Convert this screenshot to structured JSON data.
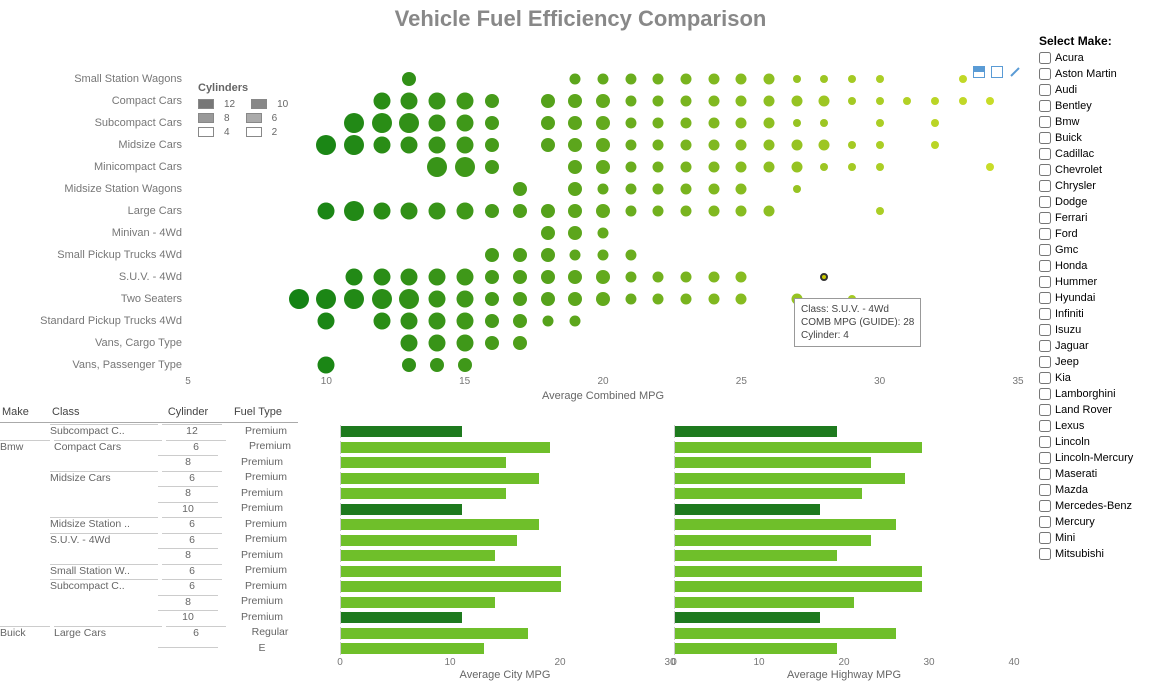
{
  "title": "Vehicle Fuel Efficiency Comparison",
  "toolbar": {
    "img_icon": "image-export",
    "win_icon": "window",
    "pen_icon": "edit"
  },
  "tooltip": {
    "line1": "Class: S.U.V. - 4Wd",
    "line2": "COMB MPG (GUIDE): 28",
    "line3": "Cylinder: 4"
  },
  "bubble_legend": {
    "title": "Cylinders",
    "items": [
      "12",
      "10",
      "8",
      "6",
      "4",
      "2"
    ]
  },
  "bubble_axis": {
    "title": "Average Combined MPG",
    "min": 5,
    "max": 35,
    "ticks": [
      5,
      10,
      15,
      20,
      25,
      30,
      35
    ]
  },
  "filter": {
    "title": "Select Make:",
    "makes": [
      "Acura",
      "Aston Martin",
      "Audi",
      "Bentley",
      "Bmw",
      "Buick",
      "Cadillac",
      "Chevrolet",
      "Chrysler",
      "Dodge",
      "Ferrari",
      "Ford",
      "Gmc",
      "Honda",
      "Hummer",
      "Hyundai",
      "Infiniti",
      "Isuzu",
      "Jaguar",
      "Jeep",
      "Kia",
      "Lamborghini",
      "Land Rover",
      "Lexus",
      "Lincoln",
      "Lincoln-Mercury",
      "Maserati",
      "Mazda",
      "Mercedes-Benz",
      "Mercury",
      "Mini",
      "Mitsubishi"
    ]
  },
  "table_headers": {
    "make": "Make",
    "class": "Class",
    "cyl": "Cylinder",
    "fuel": "Fuel Type"
  },
  "bar_titles": {
    "city": "Average City MPG",
    "hwy": "Average Highway MPG"
  },
  "bar_axis": {
    "city_ticks": [
      0,
      10,
      20,
      30
    ],
    "hwy_ticks": [
      0,
      10,
      20,
      30,
      40
    ]
  },
  "chart_data": {
    "bubble": {
      "type": "scatter",
      "xlabel": "Average Combined MPG",
      "xlim": [
        5,
        35
      ],
      "size_encoding": "Cylinders (larger circle = more cylinders)",
      "color_encoding": "higher MPG → lighter yellow-green; lower → dark green",
      "categories": [
        "Small Station Wagons",
        "Compact Cars",
        "Subcompact Cars",
        "Midsize Cars",
        "Minicompact Cars",
        "Midsize Station Wagons",
        "Large Cars",
        "Minivan - 4Wd",
        "Small Pickup Trucks 4Wd",
        "S.U.V. - 4Wd",
        "Two Seaters",
        "Standard Pickup Trucks 4Wd",
        "Vans, Cargo Type",
        "Vans, Passenger Type"
      ],
      "points": {
        "Small Station Wagons": [
          {
            "x": 13,
            "s": 3
          },
          {
            "x": 19,
            "s": 2
          },
          {
            "x": 20,
            "s": 2
          },
          {
            "x": 21,
            "s": 2
          },
          {
            "x": 22,
            "s": 2
          },
          {
            "x": 23,
            "s": 2
          },
          {
            "x": 24,
            "s": 2
          },
          {
            "x": 25,
            "s": 2
          },
          {
            "x": 26,
            "s": 2
          },
          {
            "x": 27,
            "s": 1
          },
          {
            "x": 28,
            "s": 1
          },
          {
            "x": 29,
            "s": 1
          },
          {
            "x": 30,
            "s": 1
          },
          {
            "x": 33,
            "s": 1
          }
        ],
        "Compact Cars": [
          {
            "x": 12,
            "s": 4
          },
          {
            "x": 13,
            "s": 4
          },
          {
            "x": 14,
            "s": 4
          },
          {
            "x": 15,
            "s": 4
          },
          {
            "x": 16,
            "s": 3
          },
          {
            "x": 18,
            "s": 3
          },
          {
            "x": 19,
            "s": 3
          },
          {
            "x": 20,
            "s": 3
          },
          {
            "x": 21,
            "s": 2
          },
          {
            "x": 22,
            "s": 2
          },
          {
            "x": 23,
            "s": 2
          },
          {
            "x": 24,
            "s": 2
          },
          {
            "x": 25,
            "s": 2
          },
          {
            "x": 26,
            "s": 2
          },
          {
            "x": 27,
            "s": 2
          },
          {
            "x": 28,
            "s": 2
          },
          {
            "x": 29,
            "s": 1
          },
          {
            "x": 30,
            "s": 1
          },
          {
            "x": 31,
            "s": 1
          },
          {
            "x": 32,
            "s": 1
          },
          {
            "x": 33,
            "s": 1
          },
          {
            "x": 34,
            "s": 1
          }
        ],
        "Subcompact Cars": [
          {
            "x": 11,
            "s": 5
          },
          {
            "x": 12,
            "s": 5
          },
          {
            "x": 13,
            "s": 5
          },
          {
            "x": 14,
            "s": 4
          },
          {
            "x": 15,
            "s": 4
          },
          {
            "x": 16,
            "s": 3
          },
          {
            "x": 18,
            "s": 3
          },
          {
            "x": 19,
            "s": 3
          },
          {
            "x": 20,
            "s": 3
          },
          {
            "x": 21,
            "s": 2
          },
          {
            "x": 22,
            "s": 2
          },
          {
            "x": 23,
            "s": 2
          },
          {
            "x": 24,
            "s": 2
          },
          {
            "x": 25,
            "s": 2
          },
          {
            "x": 26,
            "s": 2
          },
          {
            "x": 27,
            "s": 1
          },
          {
            "x": 28,
            "s": 1
          },
          {
            "x": 30,
            "s": 1
          },
          {
            "x": 32,
            "s": 1
          }
        ],
        "Midsize Cars": [
          {
            "x": 10,
            "s": 5
          },
          {
            "x": 11,
            "s": 5
          },
          {
            "x": 12,
            "s": 4
          },
          {
            "x": 13,
            "s": 4
          },
          {
            "x": 14,
            "s": 4
          },
          {
            "x": 15,
            "s": 4
          },
          {
            "x": 16,
            "s": 3
          },
          {
            "x": 18,
            "s": 3
          },
          {
            "x": 19,
            "s": 3
          },
          {
            "x": 20,
            "s": 3
          },
          {
            "x": 21,
            "s": 2
          },
          {
            "x": 22,
            "s": 2
          },
          {
            "x": 23,
            "s": 2
          },
          {
            "x": 24,
            "s": 2
          },
          {
            "x": 25,
            "s": 2
          },
          {
            "x": 26,
            "s": 2
          },
          {
            "x": 27,
            "s": 2
          },
          {
            "x": 28,
            "s": 2
          },
          {
            "x": 29,
            "s": 1
          },
          {
            "x": 30,
            "s": 1
          },
          {
            "x": 32,
            "s": 1
          }
        ],
        "Minicompact Cars": [
          {
            "x": 14,
            "s": 5
          },
          {
            "x": 15,
            "s": 5
          },
          {
            "x": 16,
            "s": 3
          },
          {
            "x": 19,
            "s": 3
          },
          {
            "x": 20,
            "s": 3
          },
          {
            "x": 21,
            "s": 2
          },
          {
            "x": 22,
            "s": 2
          },
          {
            "x": 23,
            "s": 2
          },
          {
            "x": 24,
            "s": 2
          },
          {
            "x": 25,
            "s": 2
          },
          {
            "x": 26,
            "s": 2
          },
          {
            "x": 27,
            "s": 2
          },
          {
            "x": 28,
            "s": 1
          },
          {
            "x": 29,
            "s": 1
          },
          {
            "x": 30,
            "s": 1
          },
          {
            "x": 34,
            "s": 1
          }
        ],
        "Midsize Station Wagons": [
          {
            "x": 17,
            "s": 3
          },
          {
            "x": 19,
            "s": 3
          },
          {
            "x": 20,
            "s": 2
          },
          {
            "x": 21,
            "s": 2
          },
          {
            "x": 22,
            "s": 2
          },
          {
            "x": 23,
            "s": 2
          },
          {
            "x": 24,
            "s": 2
          },
          {
            "x": 25,
            "s": 2
          },
          {
            "x": 27,
            "s": 1
          }
        ],
        "Large Cars": [
          {
            "x": 10,
            "s": 4
          },
          {
            "x": 11,
            "s": 5
          },
          {
            "x": 12,
            "s": 4
          },
          {
            "x": 13,
            "s": 4
          },
          {
            "x": 14,
            "s": 4
          },
          {
            "x": 15,
            "s": 4
          },
          {
            "x": 16,
            "s": 3
          },
          {
            "x": 17,
            "s": 3
          },
          {
            "x": 18,
            "s": 3
          },
          {
            "x": 19,
            "s": 3
          },
          {
            "x": 20,
            "s": 3
          },
          {
            "x": 21,
            "s": 2
          },
          {
            "x": 22,
            "s": 2
          },
          {
            "x": 23,
            "s": 2
          },
          {
            "x": 24,
            "s": 2
          },
          {
            "x": 25,
            "s": 2
          },
          {
            "x": 26,
            "s": 2
          },
          {
            "x": 30,
            "s": 1
          }
        ],
        "Minivan - 4Wd": [
          {
            "x": 18,
            "s": 3
          },
          {
            "x": 19,
            "s": 3
          },
          {
            "x": 20,
            "s": 2
          }
        ],
        "Small Pickup Trucks 4Wd": [
          {
            "x": 16,
            "s": 3
          },
          {
            "x": 17,
            "s": 3
          },
          {
            "x": 18,
            "s": 3
          },
          {
            "x": 19,
            "s": 2
          },
          {
            "x": 20,
            "s": 2
          },
          {
            "x": 21,
            "s": 2
          }
        ],
        "S.U.V. - 4Wd": [
          {
            "x": 11,
            "s": 4
          },
          {
            "x": 12,
            "s": 4
          },
          {
            "x": 13,
            "s": 4
          },
          {
            "x": 14,
            "s": 4
          },
          {
            "x": 15,
            "s": 4
          },
          {
            "x": 16,
            "s": 3
          },
          {
            "x": 17,
            "s": 3
          },
          {
            "x": 18,
            "s": 3
          },
          {
            "x": 19,
            "s": 3
          },
          {
            "x": 20,
            "s": 3
          },
          {
            "x": 21,
            "s": 2
          },
          {
            "x": 22,
            "s": 2
          },
          {
            "x": 23,
            "s": 2
          },
          {
            "x": 24,
            "s": 2
          },
          {
            "x": 25,
            "s": 2
          },
          {
            "x": 28,
            "s": 1,
            "hl": true
          }
        ],
        "Two Seaters": [
          {
            "x": 9,
            "s": 5
          },
          {
            "x": 10,
            "s": 5
          },
          {
            "x": 11,
            "s": 5
          },
          {
            "x": 12,
            "s": 5
          },
          {
            "x": 13,
            "s": 5
          },
          {
            "x": 14,
            "s": 4
          },
          {
            "x": 15,
            "s": 4
          },
          {
            "x": 16,
            "s": 3
          },
          {
            "x": 17,
            "s": 3
          },
          {
            "x": 18,
            "s": 3
          },
          {
            "x": 19,
            "s": 3
          },
          {
            "x": 20,
            "s": 3
          },
          {
            "x": 21,
            "s": 2
          },
          {
            "x": 22,
            "s": 2
          },
          {
            "x": 23,
            "s": 2
          },
          {
            "x": 24,
            "s": 2
          },
          {
            "x": 25,
            "s": 2
          },
          {
            "x": 27,
            "s": 2
          },
          {
            "x": 29,
            "s": 1
          }
        ],
        "Standard Pickup Trucks 4Wd": [
          {
            "x": 10,
            "s": 4
          },
          {
            "x": 12,
            "s": 4
          },
          {
            "x": 13,
            "s": 4
          },
          {
            "x": 14,
            "s": 4
          },
          {
            "x": 15,
            "s": 4
          },
          {
            "x": 16,
            "s": 3
          },
          {
            "x": 17,
            "s": 3
          },
          {
            "x": 18,
            "s": 2
          },
          {
            "x": 19,
            "s": 2
          }
        ],
        "Vans, Cargo Type": [
          {
            "x": 13,
            "s": 4
          },
          {
            "x": 14,
            "s": 4
          },
          {
            "x": 15,
            "s": 4
          },
          {
            "x": 16,
            "s": 3
          },
          {
            "x": 17,
            "s": 3
          }
        ],
        "Vans, Passenger Type": [
          {
            "x": 10,
            "s": 4
          },
          {
            "x": 13,
            "s": 3
          },
          {
            "x": 14,
            "s": 3
          },
          {
            "x": 15,
            "s": 3
          }
        ]
      }
    },
    "bar_table": {
      "type": "bar",
      "series_labels": [
        "Average City MPG",
        "Average Highway MPG"
      ],
      "city_lim": [
        0,
        30
      ],
      "hwy_lim": [
        0,
        40
      ],
      "rows": [
        {
          "make": "",
          "class": "Subcompact C..",
          "cyl": "12",
          "fuel": "Premium",
          "city": 11,
          "hwy": 19,
          "dark": true,
          "newclass": true
        },
        {
          "make": "Bmw",
          "class": "Compact Cars",
          "cyl": "6",
          "fuel": "Premium",
          "city": 19,
          "hwy": 29,
          "newmake": true,
          "newclass": true
        },
        {
          "make": "",
          "class": "",
          "cyl": "8",
          "fuel": "Premium",
          "city": 15,
          "hwy": 23
        },
        {
          "make": "",
          "class": "Midsize Cars",
          "cyl": "6",
          "fuel": "Premium",
          "city": 18,
          "hwy": 27,
          "newclass": true
        },
        {
          "make": "",
          "class": "",
          "cyl": "8",
          "fuel": "Premium",
          "city": 15,
          "hwy": 22
        },
        {
          "make": "",
          "class": "",
          "cyl": "10",
          "fuel": "Premium",
          "city": 11,
          "hwy": 17,
          "dark": true
        },
        {
          "make": "",
          "class": "Midsize Station ..",
          "cyl": "6",
          "fuel": "Premium",
          "city": 18,
          "hwy": 26,
          "newclass": true
        },
        {
          "make": "",
          "class": "S.U.V. - 4Wd",
          "cyl": "6",
          "fuel": "Premium",
          "city": 16,
          "hwy": 23,
          "newclass": true
        },
        {
          "make": "",
          "class": "",
          "cyl": "8",
          "fuel": "Premium",
          "city": 14,
          "hwy": 19
        },
        {
          "make": "",
          "class": "Small Station W..",
          "cyl": "6",
          "fuel": "Premium",
          "city": 20,
          "hwy": 29,
          "newclass": true
        },
        {
          "make": "",
          "class": "Subcompact C..",
          "cyl": "6",
          "fuel": "Premium",
          "city": 20,
          "hwy": 29,
          "newclass": true
        },
        {
          "make": "",
          "class": "",
          "cyl": "8",
          "fuel": "Premium",
          "city": 14,
          "hwy": 21
        },
        {
          "make": "",
          "class": "",
          "cyl": "10",
          "fuel": "Premium",
          "city": 11,
          "hwy": 17,
          "dark": true
        },
        {
          "make": "Buick",
          "class": "Large Cars",
          "cyl": "6",
          "fuel": "Regular",
          "city": 17,
          "hwy": 26,
          "newmake": true,
          "newclass": true
        },
        {
          "make": "",
          "class": "",
          "cyl": "",
          "fuel": "E",
          "city": 13,
          "hwy": 19
        }
      ]
    }
  }
}
